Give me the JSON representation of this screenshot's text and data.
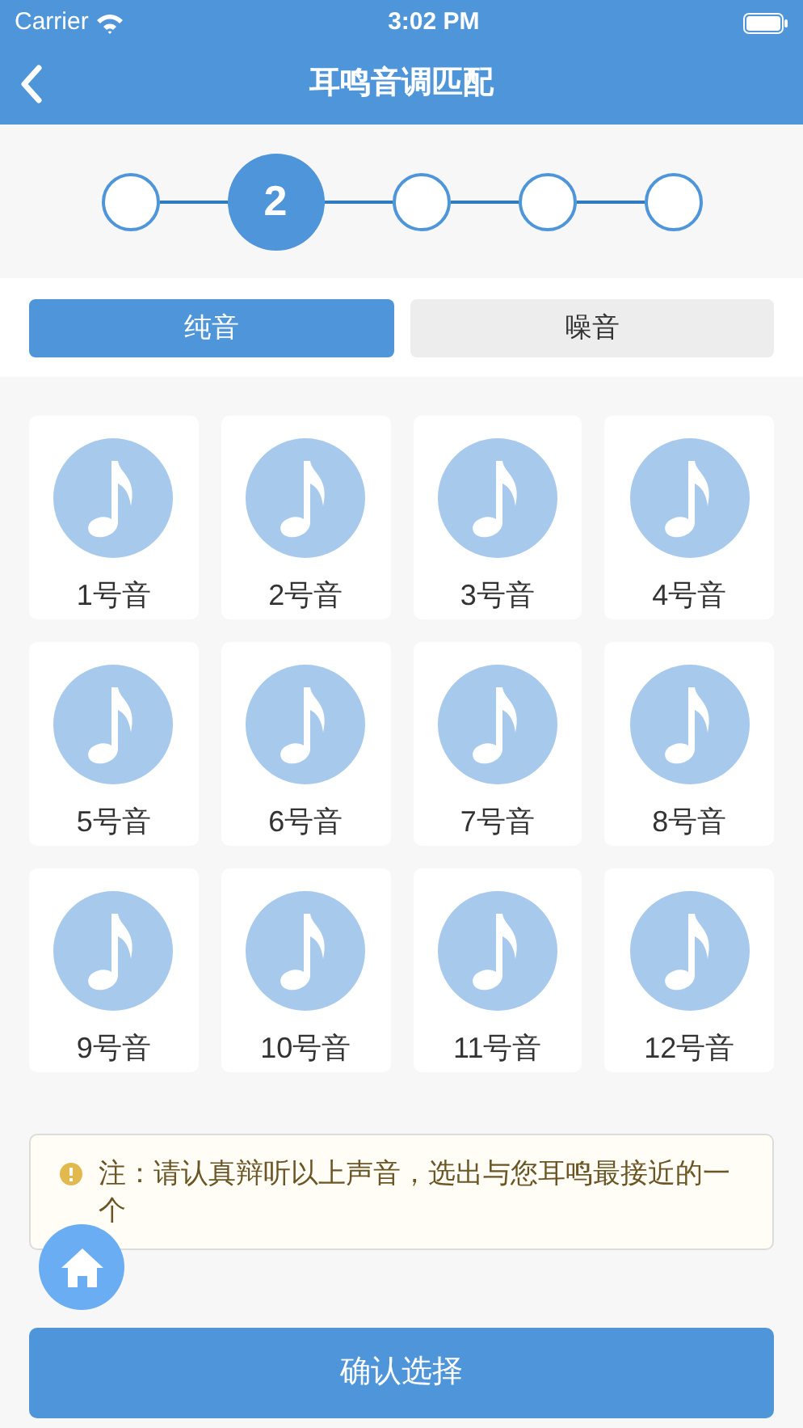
{
  "status_bar": {
    "carrier": "Carrier",
    "time": "3:02 PM"
  },
  "nav": {
    "title": "耳鸣音调匹配"
  },
  "steps": [
    {
      "selected": false
    },
    {
      "selected": true,
      "label": "2"
    },
    {
      "selected": false
    },
    {
      "selected": false
    },
    {
      "selected": false
    }
  ],
  "tabs": [
    {
      "label": "纯音",
      "selected": true
    },
    {
      "label": "噪音",
      "selected": false
    }
  ],
  "sounds": [
    {
      "label": "1号音"
    },
    {
      "label": "2号音"
    },
    {
      "label": "3号音"
    },
    {
      "label": "4号音"
    },
    {
      "label": "5号音"
    },
    {
      "label": "6号音"
    },
    {
      "label": "7号音"
    },
    {
      "label": "8号音"
    },
    {
      "label": "9号音"
    },
    {
      "label": "10号音"
    },
    {
      "label": "11号音"
    },
    {
      "label": "12号音"
    }
  ],
  "note": {
    "text": "注：请认真辩听以上声音，选出与您耳鸣最接近的一个"
  },
  "confirm_button": {
    "label": "确认选择"
  }
}
